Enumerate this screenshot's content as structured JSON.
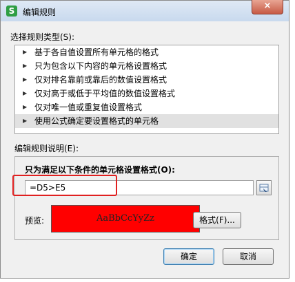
{
  "window": {
    "title": "编辑规则",
    "app_icon_letter": "S",
    "close_label": "×"
  },
  "rule_type": {
    "label": "选择规则类型(S):",
    "items": [
      "基于各自值设置所有单元格的格式",
      "只为包含以下内容的单元格设置格式",
      "仅对排名靠前或靠后的数值设置格式",
      "仅对高于或低于平均值的数值设置格式",
      "仅对唯一值或重复值设置格式",
      "使用公式确定要设置格式的单元格"
    ],
    "selected_index": 5
  },
  "rule_desc": {
    "label": "编辑规则说明(E):",
    "condition_label": "只为满足以下条件的单元格设置格式(O):",
    "formula_value": "=D5>E5",
    "preview_label": "预览:",
    "preview_text": "AaBbCcYyZz",
    "preview_color": "#ff0000",
    "format_button": "格式(F)..."
  },
  "footer": {
    "ok_label": "确定",
    "cancel_label": "取消"
  }
}
